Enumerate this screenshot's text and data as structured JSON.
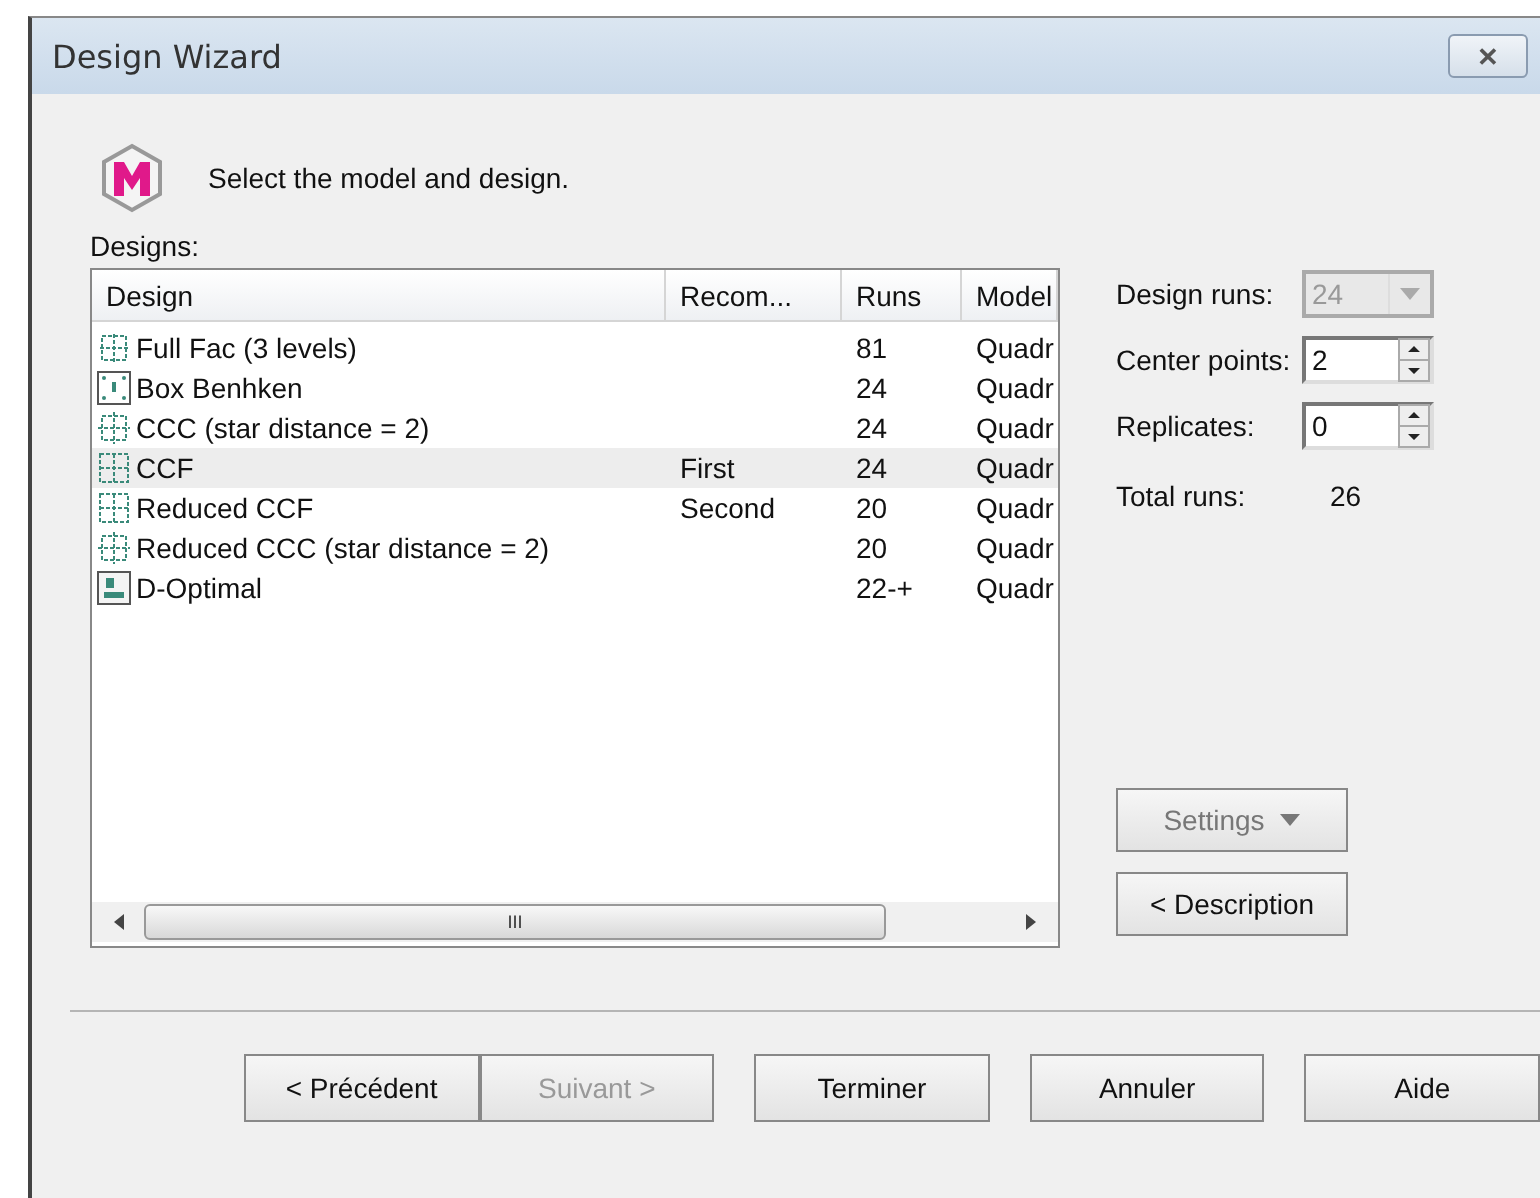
{
  "window": {
    "title": "Design Wizard",
    "close": "✕"
  },
  "instruction": "Select the model and design.",
  "designs": {
    "label": "Designs:",
    "columns": [
      "Design",
      "Recom...",
      "Runs",
      "Model"
    ],
    "rows": [
      {
        "kind": "fullfac",
        "name": "Full Fac (3 levels)",
        "recommendation": "",
        "runs": "81",
        "model": "Quadr",
        "selected": false
      },
      {
        "kind": "box",
        "name": "Box Benhken",
        "recommendation": "",
        "runs": "24",
        "model": "Quadr",
        "selected": false
      },
      {
        "kind": "ccc",
        "name": "CCC (star distance = 2)",
        "recommendation": "",
        "runs": "24",
        "model": "Quadr",
        "selected": false
      },
      {
        "kind": "ccf",
        "name": "CCF",
        "recommendation": "First",
        "runs": "24",
        "model": "Quadr",
        "selected": true
      },
      {
        "kind": "ccf",
        "name": "Reduced CCF",
        "recommendation": "Second",
        "runs": "20",
        "model": "Quadr",
        "selected": false
      },
      {
        "kind": "ccc",
        "name": "Reduced CCC (star distance = 2)",
        "recommendation": "",
        "runs": "20",
        "model": "Quadr",
        "selected": false
      },
      {
        "kind": "dopt",
        "name": "D-Optimal",
        "recommendation": "",
        "runs": "22-+",
        "model": "Quadr",
        "selected": false
      }
    ],
    "scrollbar_grip": "III"
  },
  "options": [
    {
      "kind": "dropdown",
      "label": "Design runs:",
      "value": "24",
      "disabled": true
    },
    {
      "kind": "spinner",
      "label": "Center points:",
      "value": "2"
    },
    {
      "kind": "spinner",
      "label": "Replicates:",
      "value": "0"
    },
    {
      "kind": "readout",
      "label": "Total runs:",
      "value": "26"
    }
  ],
  "side_buttons": [
    {
      "label": "Settings",
      "menu": true,
      "disabled": true
    },
    {
      "label": "< Description",
      "menu": false,
      "disabled": false
    }
  ],
  "buttons": [
    {
      "label": "< Précédent",
      "disabled": false
    },
    {
      "label": "Suivant >",
      "disabled": true
    },
    {
      "label": "Terminer",
      "disabled": false
    },
    {
      "label": "Annuler",
      "disabled": false
    },
    {
      "label": "Aide",
      "disabled": false
    }
  ]
}
